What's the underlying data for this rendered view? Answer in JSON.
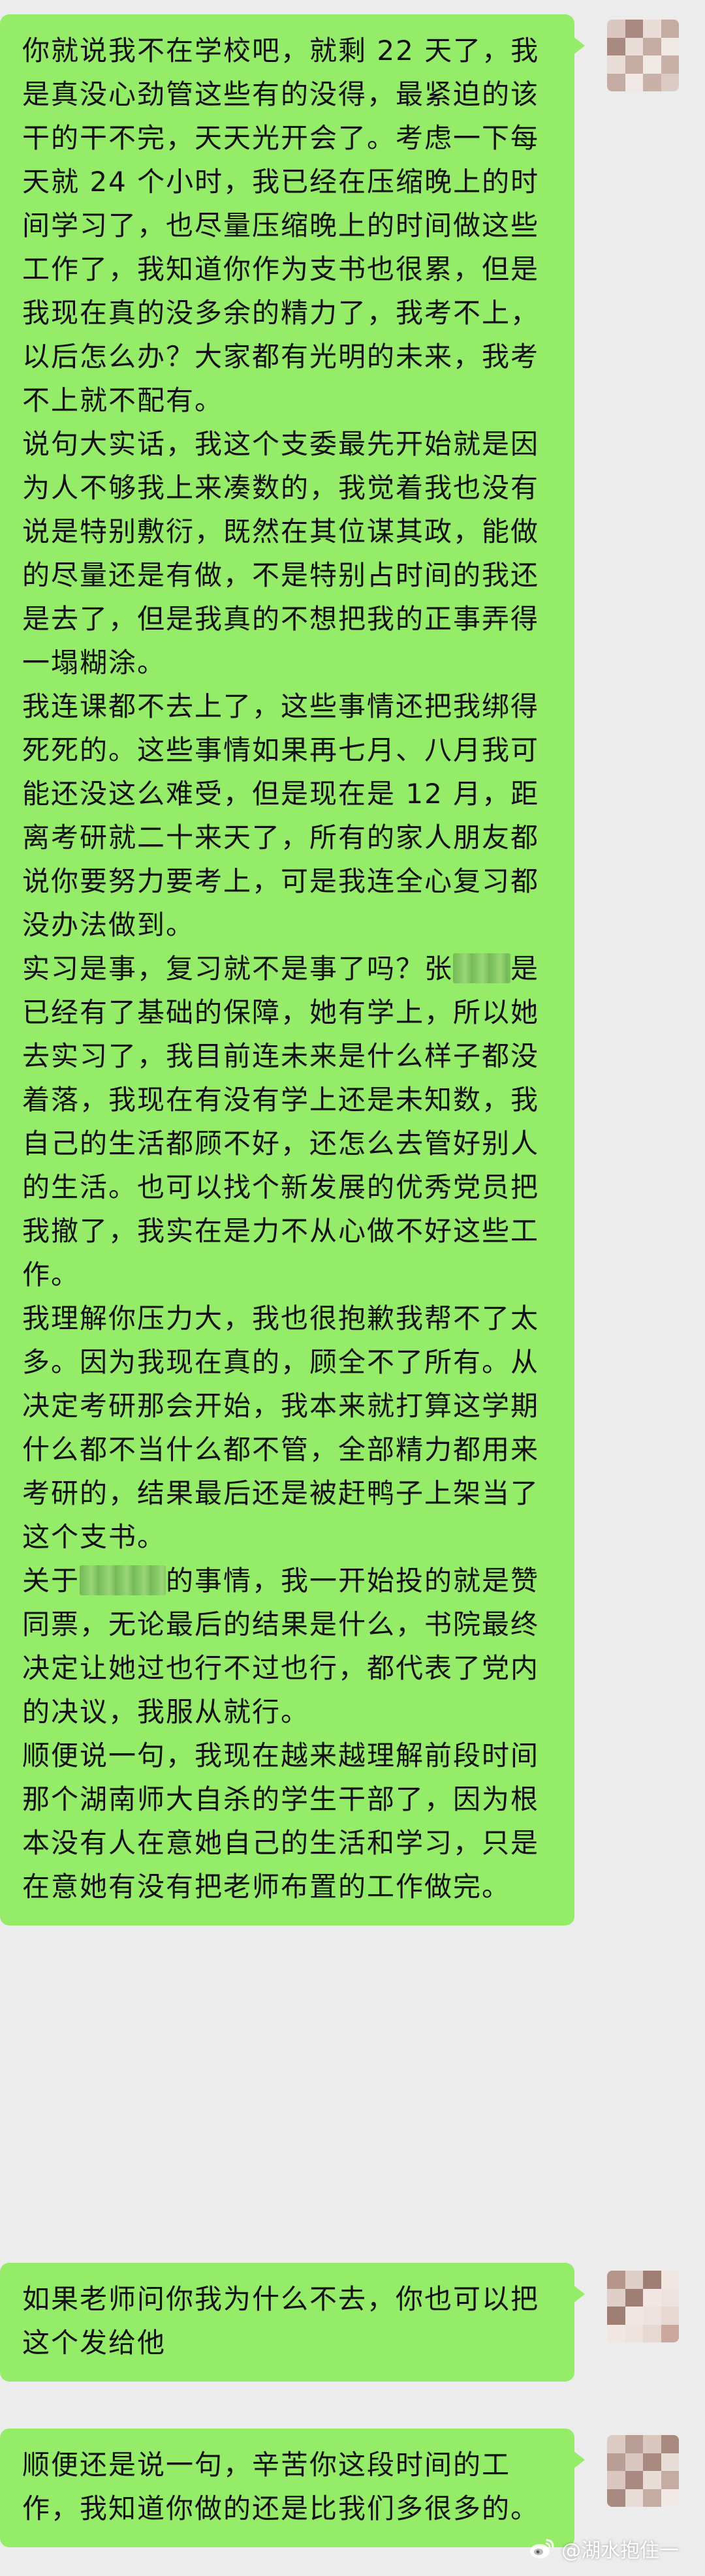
{
  "messages": [
    {
      "paragraphs": [
        [
          {
            "t": "你就说我不在学校吧，就剩 22 天了，我是真没心劲管这些有的没得，最紧迫的该干的干不完，天天光开会了。考虑一下每天就 24 个小时，我已经在压缩晚上的时间学习了，也尽量压缩晚上的时间做这些工作了，我知道你作为支书也很累，但是我现在真的没多余的精力了，我考不上，以后怎么办？大家都有光明的未来，我考不上就不配有。"
          }
        ],
        [
          {
            "t": "说句大实话，我这个支委最先开始就是因为人不够我上来凑数的，我觉着我也没有说是特别敷衍，既然在其位谋其政，能做的尽量还是有做，不是特别占时间的我还是去了，但是我真的不想把我的正事弄得一塌糊涂。"
          }
        ],
        [
          {
            "t": "我连课都不去上了，这些事情还把我绑得死死的。这些事情如果再七月、八月我可能还没这么难受，但是现在是 12 月，距离考研就二十来天了，所有的家人朋友都说你要努力要考上，可是我连全心复习都没办法做到。"
          }
        ],
        [
          {
            "t": "实习是事，复习就不是事了吗？张"
          },
          {
            "redact": 2
          },
          {
            "t": "是已经有了基础的保障，她有学上，所以她去实习了，我目前连未来是什么样子都没着落，我现在有没有学上还是未知数，我自己的生活都顾不好，还怎么去管好别人的生活。也可以找个新发展的优秀党员把我撤了，我实在是力不从心做不好这些工作。"
          }
        ],
        [
          {
            "t": "我理解你压力大，我也很抱歉我帮不了太多。因为我现在真的，顾全不了所有。从决定考研那会开始，我本来就打算这学期什么都不当什么都不管，全部精力都用来考研的，结果最后还是被赶鸭子上架当了这个支书。"
          }
        ],
        [
          {
            "t": "关于"
          },
          {
            "redact": 3
          },
          {
            "t": "的事情，我一开始投的就是赞同票，无论最后的结果是什么，书院最终决定让她过也行不过也行，都代表了党内的决议，我服从就行。"
          }
        ],
        [
          {
            "t": "顺便说一句，我现在越来越理解前段时间那个湖南师大自杀的学生干部了，因为根本没有人在意她自己的生活和学习，只是在意她有没有把老师布置的工作做完。"
          }
        ]
      ]
    },
    {
      "paragraphs": [
        [
          {
            "t": "如果老师问你我为什么不去，你也可以把这个发给他"
          }
        ]
      ]
    },
    {
      "paragraphs": [
        [
          {
            "t": "顺便还是说一句，辛苦你这段时间的工作，我知道你做的还是比我们多很多的。"
          }
        ]
      ]
    }
  ],
  "watermark": {
    "text": "@湖水抱住一"
  },
  "colors": {
    "bubble": "#95ec69",
    "background": "#ececec",
    "text": "#111111"
  }
}
